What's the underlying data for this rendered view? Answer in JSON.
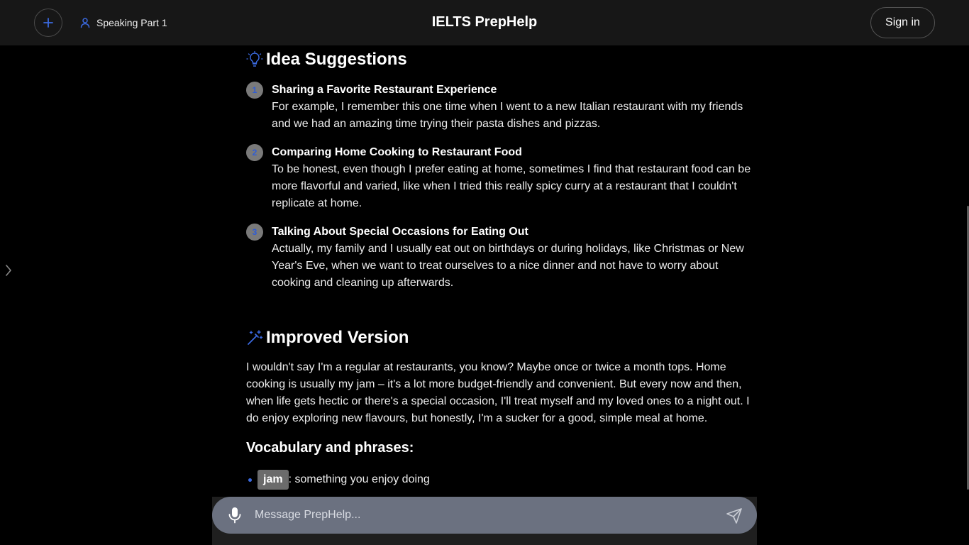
{
  "header": {
    "title": "IELTS PrepHelp",
    "mode_label": "Speaking Part 1",
    "signin_label": "Sign in"
  },
  "ideas": {
    "heading": "Idea Suggestions",
    "items": [
      {
        "num": "1",
        "title": "Sharing a Favorite Restaurant Experience",
        "text": "For example, I remember this one time when I went to a new Italian restaurant with my friends and we had an amazing time trying their pasta dishes and pizzas."
      },
      {
        "num": "2",
        "title": "Comparing Home Cooking to Restaurant Food",
        "text": "To be honest, even though I prefer eating at home, sometimes I find that restaurant food can be more flavorful and varied, like when I tried this really spicy curry at a restaurant that I couldn't replicate at home."
      },
      {
        "num": "3",
        "title": "Talking About Special Occasions for Eating Out",
        "text": "Actually, my family and I usually eat out on birthdays or during holidays, like Christmas or New Year's Eve, when we want to treat ourselves to a nice dinner and not have to worry about cooking and cleaning up afterwards."
      }
    ]
  },
  "improved": {
    "heading": "Improved Version",
    "text": "I wouldn't say I'm a regular at restaurants, you know? Maybe once or twice a month tops. Home cooking is usually my jam – it's a lot more budget-friendly and convenient. But every now and then, when life gets hectic or there's a special occasion, I'll treat myself and my loved ones to a night out. I do enjoy exploring new flavours, but honestly, I'm a sucker for a good, simple meal at home.",
    "vocab_heading": "Vocabulary and phrases:",
    "vocab": [
      {
        "term": "jam",
        "definition": ": something you enjoy doing"
      }
    ]
  },
  "composer": {
    "placeholder": "Message PrepHelp..."
  },
  "colors": {
    "accent": "#2f5dd6",
    "background": "#000000",
    "header": "#171717",
    "composer": "#6b7180"
  },
  "icons": {
    "new_chat": "plus-icon",
    "mode": "user-icon",
    "ideas": "lightbulb-icon",
    "improved": "magic-wand-icon",
    "sidebar": "chevron-right-icon",
    "mic": "microphone-icon",
    "send": "send-icon"
  }
}
